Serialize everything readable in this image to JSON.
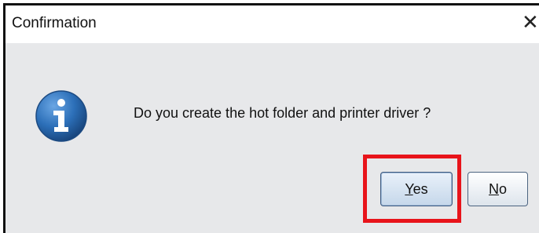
{
  "window": {
    "title": "Confirmation",
    "close_icon": "close-icon"
  },
  "message": "Do you create the hot folder and printer driver ?",
  "icon": "info-icon",
  "buttons": {
    "yes": {
      "mnemonic": "Y",
      "rest": "es"
    },
    "no": {
      "mnemonic": "N",
      "rest": "o"
    }
  },
  "colors": {
    "highlight": "#e8141b",
    "info_icon": "#2c6fb8"
  }
}
